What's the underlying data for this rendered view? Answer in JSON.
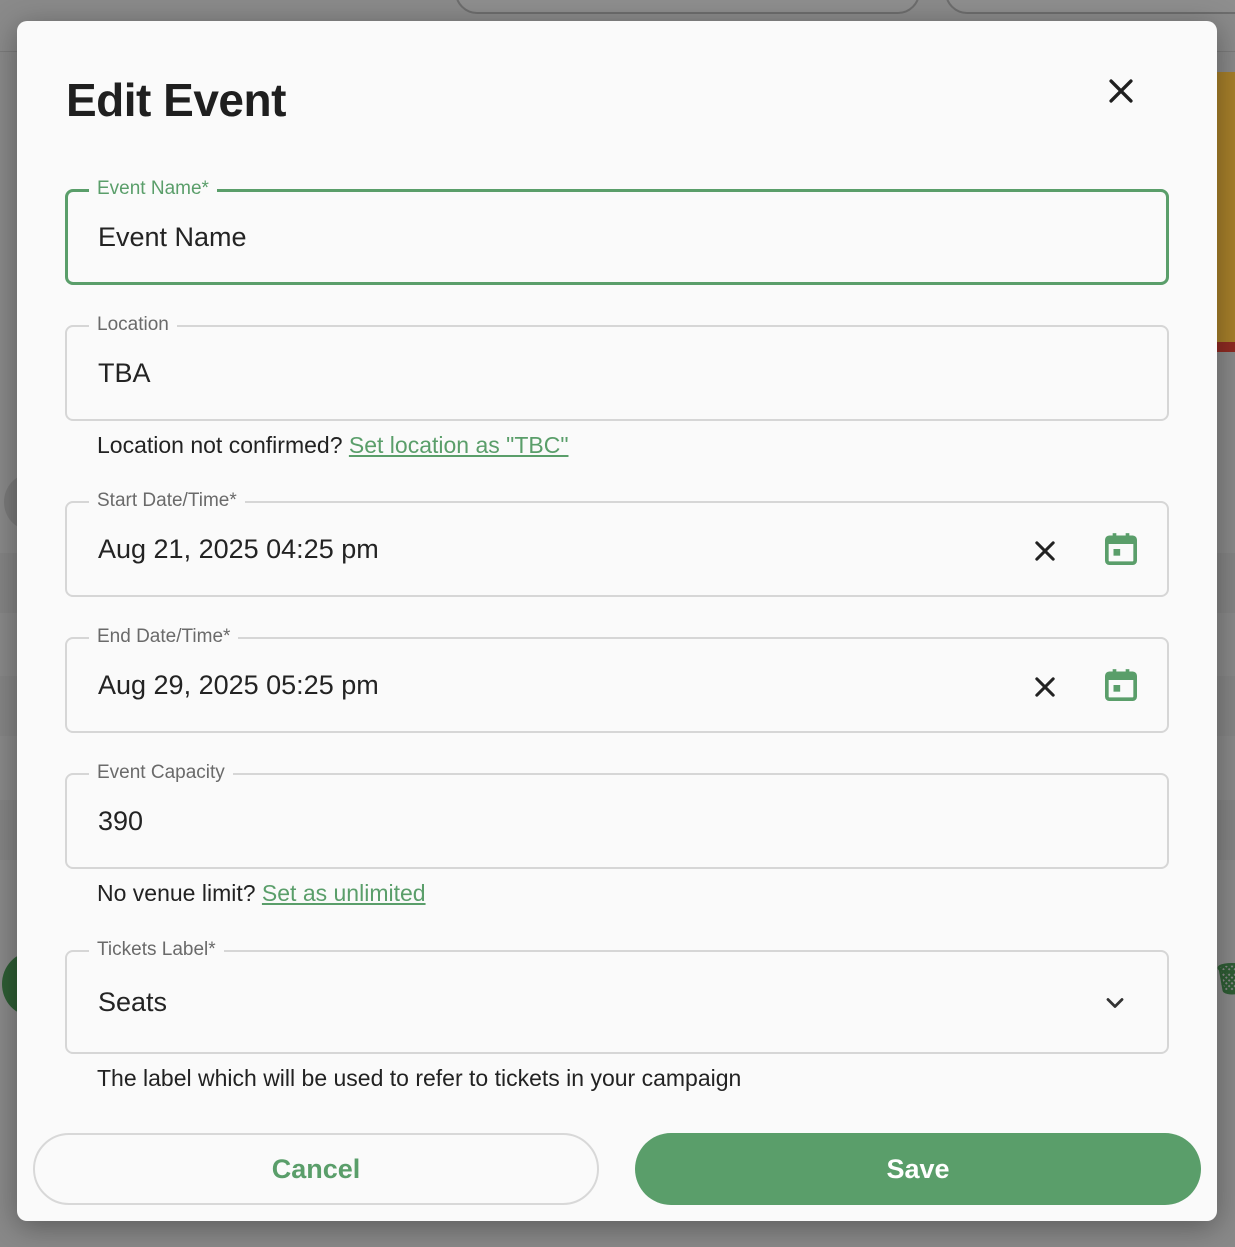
{
  "modal": {
    "title": "Edit Event"
  },
  "fields": {
    "event_name": {
      "label": "Event Name*",
      "value": "Event Name"
    },
    "location": {
      "label": "Location",
      "value": "TBA"
    },
    "location_helper": {
      "text": "Location not confirmed? ",
      "link": "Set location as \"TBC\""
    },
    "start": {
      "label": "Start Date/Time*",
      "value": "Aug 21, 2025 04:25 pm"
    },
    "end": {
      "label": "End Date/Time*",
      "value": "Aug 29, 2025 05:25 pm"
    },
    "capacity": {
      "label": "Event Capacity",
      "value": "390"
    },
    "capacity_helper": {
      "text": "No venue limit? ",
      "link": "Set as unlimited"
    },
    "tickets_label": {
      "label": "Tickets Label*",
      "value": "Seats"
    },
    "tickets_helper": "The label which will be used to refer to tickets in your campaign"
  },
  "actions": {
    "cancel": "Cancel",
    "save": "Save"
  },
  "colors": {
    "accent": "#5a9e6a",
    "text": "#232323",
    "border": "#d6d6d6"
  },
  "icons": {
    "close": "close-icon",
    "clear": "clear-icon",
    "calendar": "calendar-icon",
    "dropdown": "chevron-down-icon"
  }
}
